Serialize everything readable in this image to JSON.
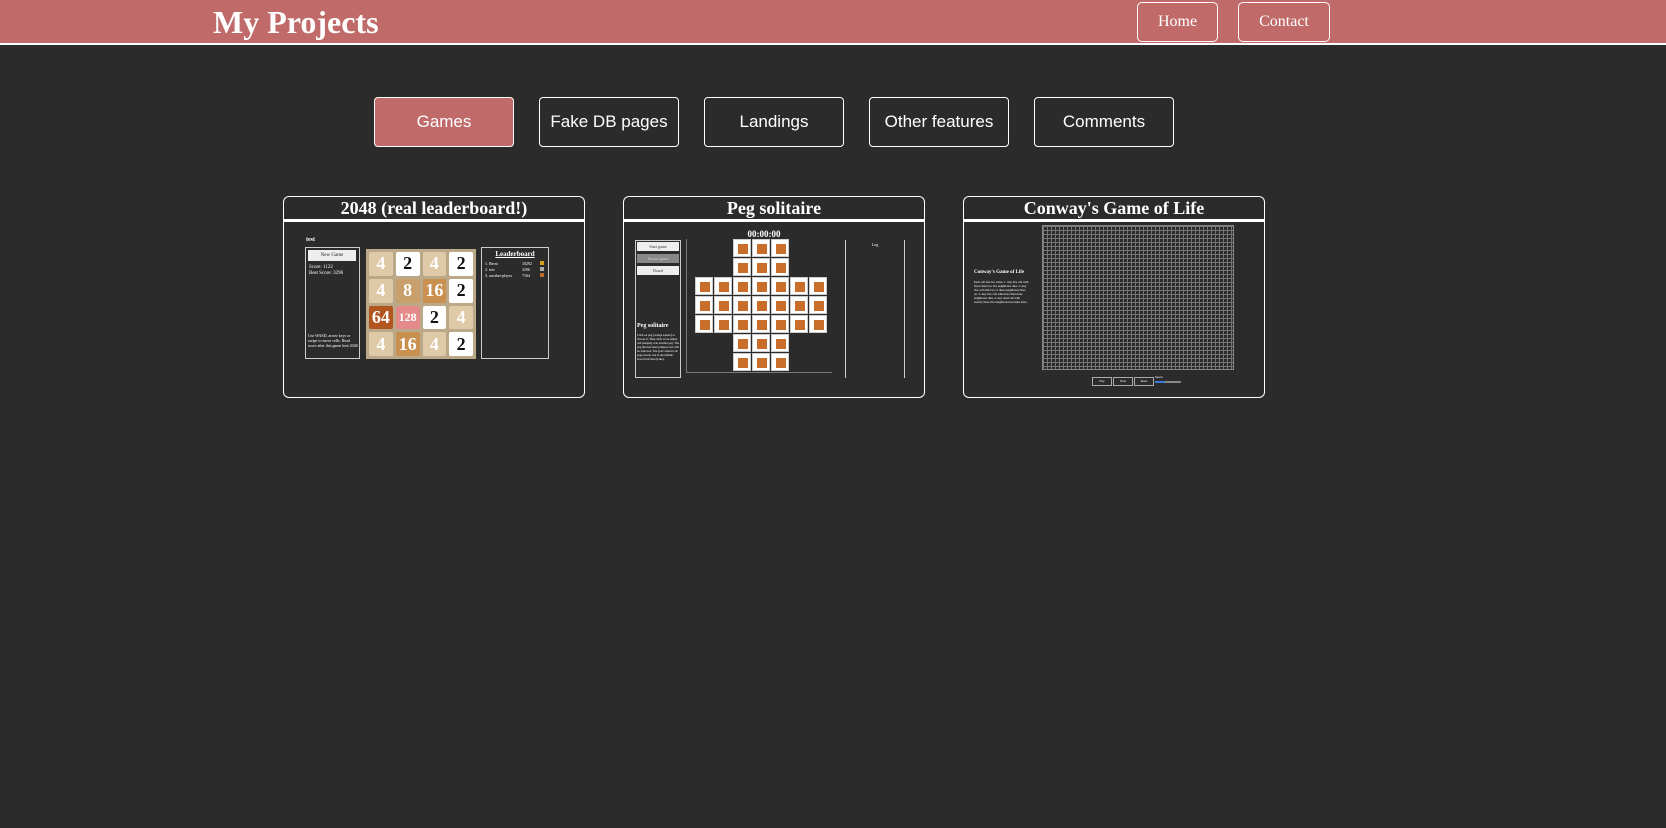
{
  "header": {
    "title": "My Projects",
    "nav": [
      {
        "label": "Home",
        "name": "nav-home-button"
      },
      {
        "label": "Contact",
        "name": "nav-contact-button"
      }
    ]
  },
  "tabs": [
    {
      "label": "Games",
      "active": true
    },
    {
      "label": "Fake DB pages",
      "active": false
    },
    {
      "label": "Landings",
      "active": false
    },
    {
      "label": "Other features",
      "active": false
    },
    {
      "label": "Comments",
      "active": false
    }
  ],
  "cards": [
    {
      "title": "2048 (real leaderboard!)",
      "preview": {
        "user": "test",
        "new_game": "New Game",
        "score": "Score: 1122",
        "best": "Best Score: 3296",
        "hint": "Use WASD, arrow keys or swipe to move cells. Head score after this game best 2048",
        "board": [
          "4",
          "2",
          "4",
          "2",
          "4",
          "8",
          "16",
          "2",
          "64",
          "128",
          "2",
          "4",
          "4",
          "16",
          "4",
          "2"
        ],
        "leaderboard_title": "Leaderboard",
        "leaderboard": [
          {
            "rank": "1. Berni",
            "score": "10292"
          },
          {
            "rank": "2. test",
            "score": "3296"
          },
          {
            "rank": "3. another-player",
            "score": "7164"
          }
        ]
      }
    },
    {
      "title": "Peg solitaire",
      "preview": {
        "timer": "00:00:00",
        "buttons": [
          "Start game",
          "Restart game",
          "Board"
        ],
        "heading": "Peg solitaire",
        "desc": "Click on peg (orange square) to choose it. Then click on an empty cell jumping over another peg. The peg that has been jumped over will be removed. The goal: remove all pegs except one in the middle. Good luck then (Like).",
        "side": "Log"
      }
    },
    {
      "title": "Conway's Game of Life",
      "preview": {
        "heading": "Conway's Game of Life",
        "rules": "Each cell has two states. 1. Any live cell with fewer than two live neighbours dies. 2. Any live cell with two or three neighbours lives on. 3. Any live cell with more than three neighbours dies. 4. Any dead cell with exactly three live neighbours becomes alive.",
        "controls": [
          "Play",
          "Next",
          "Reset"
        ],
        "speed": "Speed"
      }
    }
  ]
}
